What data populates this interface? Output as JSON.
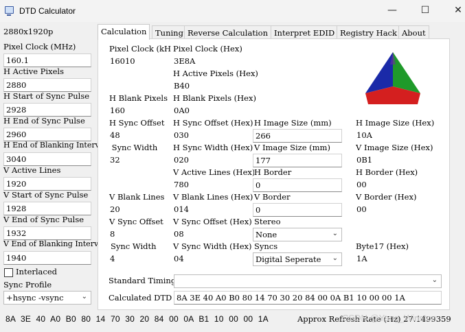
{
  "window": {
    "title": "DTD Calculator",
    "minimize_glyph": "—",
    "maximize_glyph": "☐",
    "close_glyph": "✕"
  },
  "left": {
    "resolution": "2880x1920p",
    "fields": [
      {
        "label": "Pixel Clock (MHz)",
        "value": "160.1"
      },
      {
        "label": "H Active Pixels",
        "value": "2880"
      },
      {
        "label": "H Start of Sync Pulse",
        "value": "2928"
      },
      {
        "label": "H End of Sync Pulse",
        "value": "2960"
      },
      {
        "label": "H End of Blanking Interval",
        "value": "3040"
      },
      {
        "label": "V Active Lines",
        "value": "1920"
      },
      {
        "label": "V Start of Sync Pulse",
        "value": "1928"
      },
      {
        "label": "V End of Sync Pulse",
        "value": "1932"
      },
      {
        "label": "V End of Blanking Interval",
        "value": "1940"
      }
    ],
    "interlaced_label": "Interlaced",
    "interlaced_checked": false,
    "sync_profile_label": "Sync Profile",
    "sync_profile_value": "+hsync -vsync"
  },
  "tabs": [
    {
      "label": "Calculation",
      "active": true
    },
    {
      "label": "Tuning",
      "active": false
    },
    {
      "label": "Reverse Calculation",
      "active": false
    },
    {
      "label": "Interpret EDID",
      "active": false
    },
    {
      "label": "Registry Hack",
      "active": false
    },
    {
      "label": "About",
      "active": false
    }
  ],
  "calc": {
    "col1": [
      {
        "label": "Pixel Clock (kH",
        "value": "16010"
      },
      {
        "label": "H Blank Pixels",
        "value": "160"
      },
      {
        "label": "H Sync Offset",
        "value": "48"
      },
      {
        "label": "H Sync Width",
        "value": "32"
      },
      {
        "label": "V Blank Lines",
        "value": "20"
      },
      {
        "label": "V Sync Offset",
        "value": "8"
      },
      {
        "label": "V Sync Width",
        "value": "4"
      }
    ],
    "col2": [
      {
        "label": "Pixel Clock (Hex)",
        "value": "3E8A"
      },
      {
        "label": "H Active Pixels (Hex)",
        "value": "B40"
      },
      {
        "label": "H Blank Pixels (Hex)",
        "value": "0A0"
      },
      {
        "label": "H Sync Offset (Hex)",
        "value": "030"
      },
      {
        "label": "H Sync Width (Hex)",
        "value": "020"
      },
      {
        "label": "V Active Lines (Hex)",
        "value": "780"
      },
      {
        "label": "V Blank Lines (Hex)",
        "value": "014"
      },
      {
        "label": "V Sync Offset (Hex)",
        "value": "08"
      },
      {
        "label": "V Sync Width (Hex)",
        "value": "04"
      }
    ],
    "col3": [
      {
        "label": "H Image Size (mm)",
        "value": "266"
      },
      {
        "label": "V Image Size (mm)",
        "value": "177"
      },
      {
        "label": "H Border",
        "value": "0"
      },
      {
        "label": "V Border",
        "value": "0"
      }
    ],
    "stereo_label": "Stereo",
    "stereo_value": "None",
    "syncs_label": "Syncs",
    "syncs_value": "Digital Seperate",
    "col4": [
      {
        "label": "H Image Size (Hex)",
        "value": "10A"
      },
      {
        "label": "V Image Size (Hex)",
        "value": "0B1"
      },
      {
        "label": "H Border (Hex)",
        "value": "00"
      },
      {
        "label": "V Border (Hex)",
        "value": "00"
      },
      {
        "label": "Byte17 (Hex)",
        "value": "1A"
      }
    ],
    "standard_timings_label": "Standard Timings",
    "standard_timings_value": "",
    "calculated_dtd_label": "Calculated DTD",
    "calculated_dtd_value": "8A 3E 40 A0 B0 80 14 70 30 20 84 00 0A B1 10 00 00 1A"
  },
  "status": {
    "bytes": "8A 3E 40 A0 B0 80 14 70 30 20 84 00 0A B1 10 00 00 1A",
    "refresh_rate": "Approx Refresh Rate (Hz) 27.1499359",
    "watermark": "CSDN @Yang_Winston"
  },
  "logo_colors": {
    "left": "#1a2aa8",
    "right": "#1f9a2a",
    "bottom": "#d41f1f",
    "top": "#6c2ea0"
  }
}
